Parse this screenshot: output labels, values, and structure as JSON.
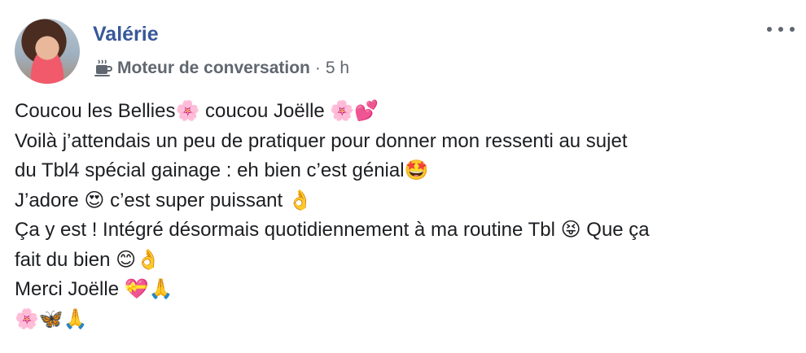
{
  "post": {
    "author": "Valérie",
    "group": "Moteur de conversation",
    "separator": "·",
    "time": "5 h",
    "group_icon": "coffee-cup-icon",
    "more_icon": "more-options-icon",
    "lines": [
      "Coucou les Bellies🌸 coucou Joëlle 🌸💕",
      "Voilà j’attendais un peu de pratiquer pour donner mon ressenti au sujet",
      "du Tbl4 spécial gainage : eh bien c’est génial🤩",
      "J’adore 😍 c’est super puissant 👌",
      "Ça y est ! Intégré désormais quotidiennement à ma routine Tbl 😝 Que ça",
      "fait du bien 😊👌",
      "Merci Joëlle 💝🙏",
      "🌸🦋🙏"
    ]
  },
  "colors": {
    "author": "#385898",
    "meta": "#606770",
    "text": "#1c1e21",
    "background": "#ffffff"
  }
}
